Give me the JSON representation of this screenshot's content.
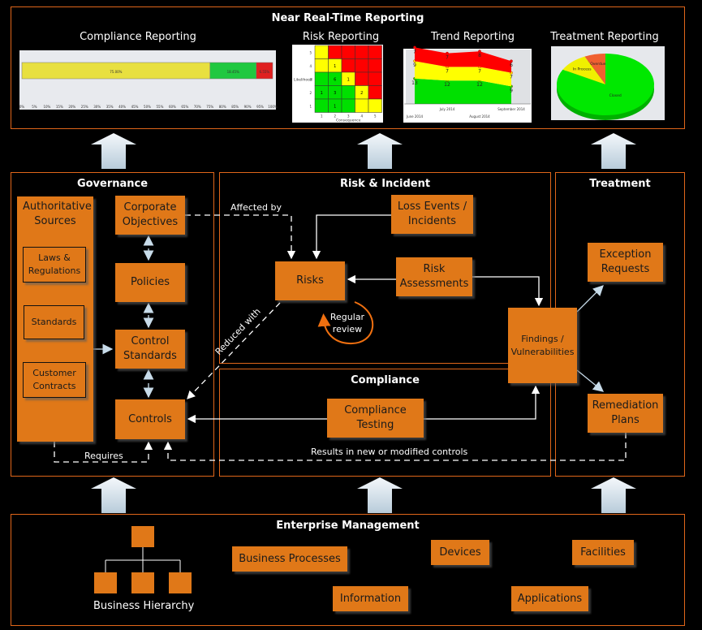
{
  "reporting": {
    "title": "Near Real-Time Reporting",
    "charts": [
      "Compliance Reporting",
      "Risk Reporting",
      "Trend Reporting",
      "Treatment Reporting"
    ]
  },
  "governance": {
    "title": "Governance",
    "authoritative_sources": "Authoritative Sources",
    "laws": "Laws & Regulations",
    "standards": "Standards",
    "contracts": "Customer Contracts",
    "corporate_objectives": "Corporate Objectives",
    "policies": "Policies",
    "control_standards": "Control Standards",
    "controls": "Controls",
    "requires": "Requires"
  },
  "risk": {
    "title": "Risk & Incident",
    "risks": "Risks",
    "loss_events": "Loss Events / Incidents",
    "assessments": "Risk Assessments",
    "affected_by": "Affected by",
    "reduced_with": "Reduced with",
    "regular_review": "Regular review"
  },
  "compliance": {
    "title": "Compliance",
    "testing": "Compliance Testing",
    "results": "Results in new or modified controls"
  },
  "findings": "Findings / Vulnerabilities",
  "treatment": {
    "title": "Treatment",
    "exception": "Exception Requests",
    "remediation": "Remediation Plans"
  },
  "enterprise": {
    "title": "Enterprise Management",
    "hierarchy": "Business Hierarchy",
    "processes": "Business Processes",
    "devices": "Devices",
    "facilities": "Facilities",
    "information": "Information",
    "applications": "Applications"
  },
  "colors": {
    "accent": "#e07818",
    "border": "#e0661a",
    "arrow": "#dce8f0",
    "red": "#ff0000",
    "yellow": "#ffff00",
    "green": "#00e000"
  },
  "chart_data": [
    {
      "type": "bar",
      "orientation": "stacked-horizontal",
      "labels": [
        "75.00%",
        "18.45%",
        "6.55%"
      ],
      "values": [
        75.0,
        18.45,
        6.55
      ],
      "colors": [
        "#e8e040",
        "#20c840",
        "#e02020"
      ],
      "xlim": [
        0,
        100
      ],
      "xticks": [
        "0%",
        "5%",
        "10%",
        "15%",
        "20%",
        "25%",
        "30%",
        "35%",
        "40%",
        "45%",
        "50%",
        "55%",
        "60%",
        "65%",
        "70%",
        "75%",
        "80%",
        "85%",
        "90%",
        "95%",
        "100%"
      ]
    },
    {
      "type": "heatmap",
      "xlabel": "Consequence",
      "ylabel": "Likelihood",
      "x": [
        1,
        2,
        3,
        4,
        5
      ],
      "y": [
        5,
        4,
        3,
        2,
        1
      ],
      "cells": [
        [
          "Y",
          "R",
          "R",
          "R",
          "R"
        ],
        [
          "Y",
          "Y",
          "R",
          "R",
          "R"
        ],
        [
          "G",
          "G",
          "Y",
          "R",
          "R"
        ],
        [
          "G",
          "G",
          "G",
          "Y",
          "R"
        ],
        [
          "G",
          "G",
          "G",
          "Y",
          "Y"
        ]
      ],
      "counts": [
        [
          "",
          "",
          "",
          "",
          ""
        ],
        [
          "",
          "1",
          "",
          "",
          ""
        ],
        [
          "",
          "6",
          "1",
          "",
          ""
        ],
        [
          "1",
          "3",
          "",
          "2",
          ""
        ],
        [
          "",
          "1",
          "",
          "",
          ""
        ]
      ]
    },
    {
      "type": "area",
      "categories": [
        "June 2014",
        "July 2014",
        "August 2014",
        "September 2014"
      ],
      "series": [
        {
          "color": "#00e000",
          "values": [
            13,
            12,
            12,
            9
          ]
        },
        {
          "color": "#ffff00",
          "values": [
            9,
            7,
            7,
            7
          ]
        },
        {
          "color": "#ff0000",
          "values": [
            7,
            7,
            8,
            6
          ]
        }
      ],
      "stacked": true
    },
    {
      "type": "pie",
      "labels": [
        "Closed",
        "In Process",
        "Overdue"
      ],
      "values": [
        83,
        10,
        7
      ],
      "colors": [
        "#00e800",
        "#f0f000",
        "#f06030"
      ]
    }
  ]
}
